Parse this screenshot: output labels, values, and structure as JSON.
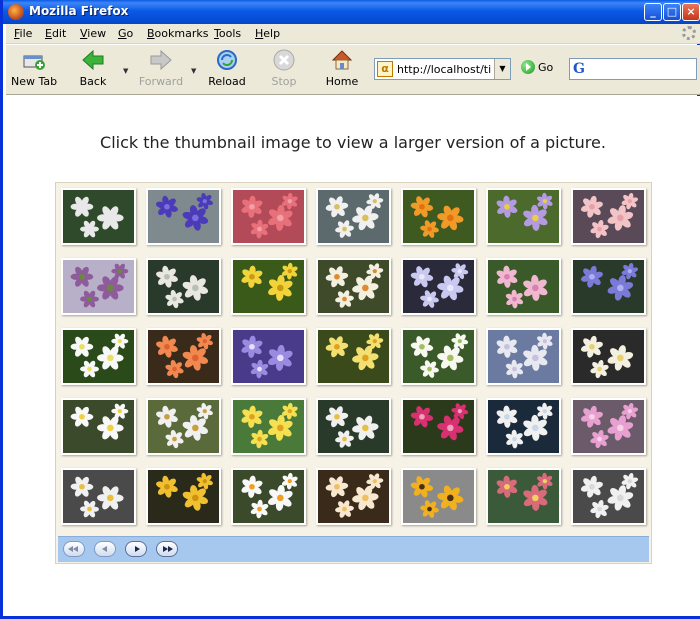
{
  "window": {
    "title": "Mozilla Firefox"
  },
  "menubar": {
    "items": [
      "File",
      "Edit",
      "View",
      "Go",
      "Bookmarks",
      "Tools",
      "Help"
    ]
  },
  "toolbar": {
    "buttons": [
      {
        "label": "New Tab",
        "icon": "new-tab-icon",
        "enabled": true
      },
      {
        "label": "Back",
        "icon": "back-arrow-icon",
        "enabled": true
      },
      {
        "label": "Forward",
        "icon": "forward-arrow-icon",
        "enabled": false
      },
      {
        "label": "Reload",
        "icon": "reload-icon",
        "enabled": true
      },
      {
        "label": "Stop",
        "icon": "stop-icon",
        "enabled": false
      },
      {
        "label": "Home",
        "icon": "home-icon",
        "enabled": true
      }
    ],
    "url": "http://localhost/tile",
    "go_label": "Go",
    "search_engine_icon": "google-icon"
  },
  "content": {
    "instructions": "Click the thumbnail image to view a larger version of a picture.",
    "thumbnails": [
      {
        "bg": "#2f4a2a",
        "petal": "#e8e8e8",
        "center": "#e8e8e8"
      },
      {
        "bg": "#7f8a8f",
        "petal": "#4b3bb8",
        "center": "#7b6ee0"
      },
      {
        "bg": "#b24a58",
        "petal": "#e8707a",
        "center": "#f2a0a8"
      },
      {
        "bg": "#5c6a6e",
        "petal": "#f0f0f0",
        "center": "#d8c060"
      },
      {
        "bg": "#3e5a20",
        "petal": "#f09a28",
        "center": "#e27010"
      },
      {
        "bg": "#4b6a2c",
        "petal": "#b49ae0",
        "center": "#e8d040"
      },
      {
        "bg": "#5a4a58",
        "petal": "#f2c4c8",
        "center": "#e8a0a8"
      },
      {
        "bg": "#b8b0c8",
        "petal": "#8e5c9a",
        "center": "#6a8a3a"
      },
      {
        "bg": "#2a3a2a",
        "petal": "#e8e8e0",
        "center": "#b8c0b0"
      },
      {
        "bg": "#3a5a1a",
        "petal": "#f2d43a",
        "center": "#c89a10"
      },
      {
        "bg": "#3f4a2a",
        "petal": "#f4f0e0",
        "center": "#e08a30"
      },
      {
        "bg": "#2a2a3a",
        "petal": "#c8c8f0",
        "center": "#e8e8f8"
      },
      {
        "bg": "#3a5a2a",
        "petal": "#f0b8d0",
        "center": "#d880b0"
      },
      {
        "bg": "#2a3a2a",
        "petal": "#7a7ad8",
        "center": "#b0b0f0"
      },
      {
        "bg": "#2a4a1a",
        "petal": "#f8f8f8",
        "center": "#e8e060"
      },
      {
        "bg": "#3a2a1a",
        "petal": "#f08850",
        "center": "#e06030"
      },
      {
        "bg": "#4a3a8a",
        "petal": "#9a8ae0",
        "center": "#e8e0ff"
      },
      {
        "bg": "#3a4a1a",
        "petal": "#f4e070",
        "center": "#e0a020"
      },
      {
        "bg": "#3a5a2a",
        "petal": "#f8f8f0",
        "center": "#a0c060"
      },
      {
        "bg": "#6a7aa0",
        "petal": "#e8e8f0",
        "center": "#c8c0e0"
      },
      {
        "bg": "#2a2a2a",
        "petal": "#f4f0e0",
        "center": "#e8d070"
      },
      {
        "bg": "#3a4a2a",
        "petal": "#f8f8f8",
        "center": "#f0d040"
      },
      {
        "bg": "#5a6a3a",
        "petal": "#f0f0f0",
        "center": "#c8a040"
      },
      {
        "bg": "#4a7a3a",
        "petal": "#f4e050",
        "center": "#e0a020"
      },
      {
        "bg": "#2a3a2a",
        "petal": "#f0f0f0",
        "center": "#e8c040"
      },
      {
        "bg": "#2a3a1a",
        "petal": "#d83070",
        "center": "#f0a0b8"
      },
      {
        "bg": "#1a2a3a",
        "petal": "#f0f0f0",
        "center": "#c8d8e8"
      },
      {
        "bg": "#6a5a6a",
        "petal": "#e8a0d0",
        "center": "#f8d0e8"
      },
      {
        "bg": "#4a4a4a",
        "petal": "#f0f0f0",
        "center": "#e8c040"
      },
      {
        "bg": "#2a2a1a",
        "petal": "#f0c030",
        "center": "#d09010"
      },
      {
        "bg": "#3a4a2a",
        "petal": "#f8f8f8",
        "center": "#f0a020"
      },
      {
        "bg": "#3a2a1a",
        "petal": "#f8e8d0",
        "center": "#f0c060"
      },
      {
        "bg": "#8a8a8a",
        "petal": "#f0b020",
        "center": "#4a3010"
      },
      {
        "bg": "#3a5a3a",
        "petal": "#d86a7a",
        "center": "#f0d060"
      },
      {
        "bg": "#4a4a4a",
        "petal": "#f0f0f0",
        "center": "#d8d8d8"
      }
    ]
  },
  "pager": {
    "buttons": [
      {
        "icon": "first-page-icon",
        "enabled": false
      },
      {
        "icon": "previous-page-icon",
        "enabled": false
      },
      {
        "icon": "next-page-icon",
        "enabled": true
      },
      {
        "icon": "last-page-icon",
        "enabled": true
      }
    ]
  }
}
